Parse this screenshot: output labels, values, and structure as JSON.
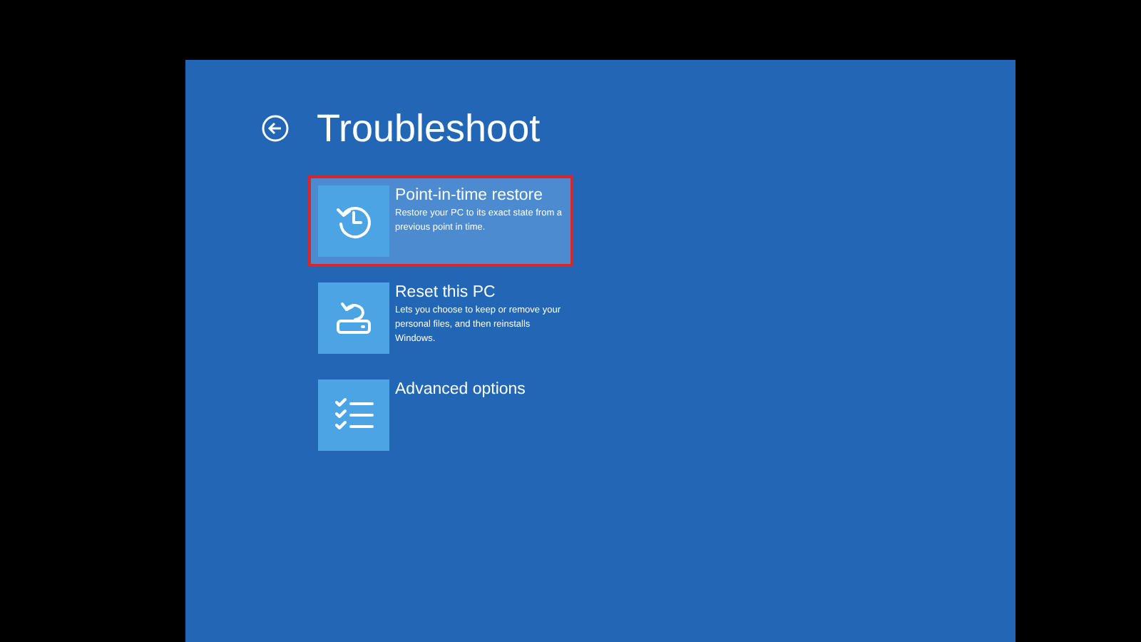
{
  "title": "Troubleshoot",
  "options": [
    {
      "kind": "restore",
      "label": "Point-in-time restore",
      "description": "Restore your PC to its exact state from a previous point in time.",
      "selected": true
    },
    {
      "kind": "reset",
      "label": "Reset this PC",
      "description": "Lets you choose to keep or remove your personal files, and then reinstalls Windows.",
      "selected": false
    },
    {
      "kind": "advanced",
      "label": "Advanced options",
      "selected": false
    }
  ]
}
